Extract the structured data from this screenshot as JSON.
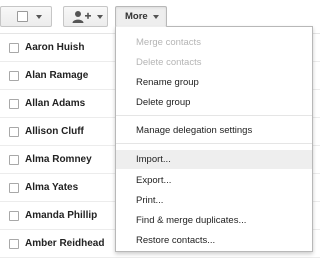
{
  "toolbar": {
    "more_label": "More",
    "select_checkbox_icon": "checkbox-icon",
    "add_people_icon": "add-person-icon",
    "dropdown_icon": "caret-down-icon"
  },
  "contacts": [
    "Aaron Huish",
    "Alan Ramage",
    "Allan Adams",
    "Allison Cluff",
    "Alma Romney",
    "Alma Yates",
    "Amanda Phillip",
    "Amber Reidhead"
  ],
  "menu": {
    "merge_contacts": "Merge contacts",
    "delete_contacts": "Delete contacts",
    "rename_group": "Rename group",
    "delete_group": "Delete group",
    "manage_delegation": "Manage delegation settings",
    "import": "Import...",
    "export": "Export...",
    "print": "Print...",
    "find_merge_duplicates": "Find & merge duplicates...",
    "restore_contacts": "Restore contacts..."
  },
  "colors": {
    "menu_highlight": "#eeeeee",
    "disabled_text": "#b5b5b5",
    "text": "#222222"
  }
}
